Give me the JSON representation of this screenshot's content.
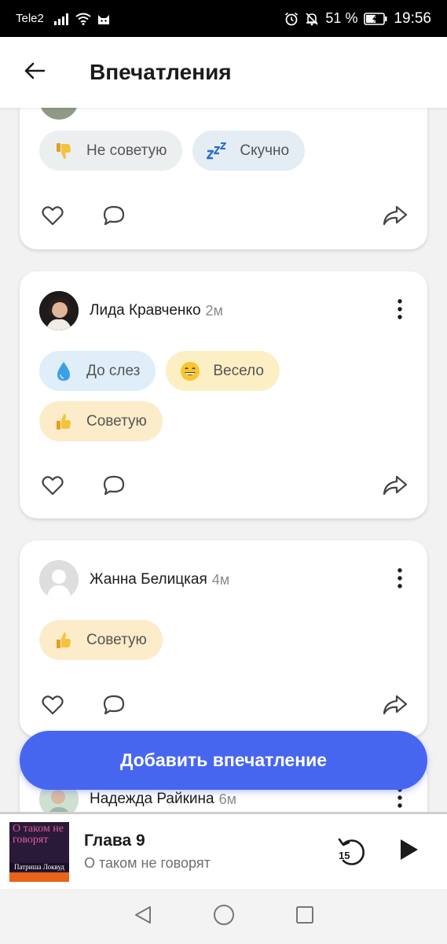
{
  "status_bar": {
    "carrier": "Tele2",
    "battery_percent": "51 %",
    "time": "19:56",
    "icons": [
      "signal-icon",
      "wifi-icon",
      "cat-app-icon",
      "alarm-icon",
      "mute-icon",
      "battery-icon"
    ]
  },
  "header": {
    "title": "Впечатления",
    "back_icon": "arrow-left-icon"
  },
  "feed": {
    "posts": [
      {
        "user": "",
        "time": "",
        "partial": true,
        "reactions": [
          {
            "label": "Не советую",
            "icon": "thumbs-down-icon"
          },
          {
            "label": "Скучно",
            "icon": "zzz-icon"
          }
        ]
      },
      {
        "user": "Лида Кравченко",
        "time": "2м",
        "reactions": [
          {
            "label": "До слез",
            "icon": "teardrop-icon"
          },
          {
            "label": "Весело",
            "icon": "grin-icon"
          },
          {
            "label": "Советую",
            "icon": "thumbs-up-icon"
          }
        ]
      },
      {
        "user": "Жанна Белицкая",
        "time": "4м",
        "reactions": [
          {
            "label": "Советую",
            "icon": "thumbs-up-icon"
          }
        ]
      },
      {
        "user": "Надежда Райкина",
        "time": "6м",
        "partial": true,
        "reactions": []
      }
    ]
  },
  "add_button": {
    "label": "Добавить впечатление"
  },
  "player": {
    "chapter": "Глава 9",
    "book": "О таком не говорят",
    "cover_title": "О таком не говорят",
    "cover_author": "Патриша Локвуд",
    "rewind_seconds": "15",
    "progress": 0
  },
  "colors": {
    "accent": "#4766f0",
    "chip_negative": "#eceff0",
    "chip_bored": "#e4ecf4",
    "chip_tears": "#dfeef9",
    "chip_fun": "#fcefc4",
    "chip_recommend": "#fcecc9"
  }
}
